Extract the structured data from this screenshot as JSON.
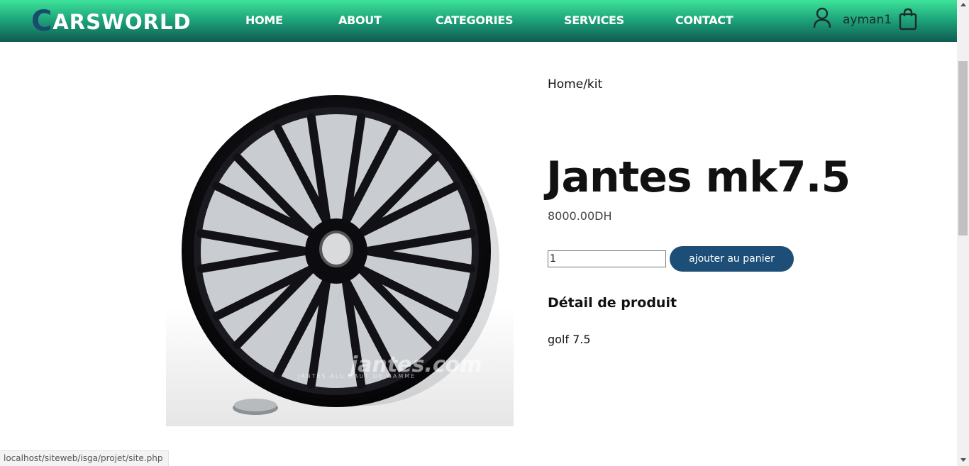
{
  "header": {
    "logo_first": "C",
    "logo_rest": "ARSWORLD",
    "nav": [
      {
        "label": "HOME"
      },
      {
        "label": "ABOUT"
      },
      {
        "label": "CATEGORIES"
      },
      {
        "label": "SERVICES"
      },
      {
        "label": "CONTACT"
      }
    ],
    "username": "ayman1",
    "icons": {
      "user": "user-icon",
      "cart": "shopping-bag-icon"
    }
  },
  "product": {
    "breadcrumb": "Home/kit",
    "title": "Jantes mk7.5",
    "price": "8000.00DH",
    "quantity": "1",
    "add_to_cart_label": "ajouter au panier",
    "detail_heading": "Détail de produit",
    "detail_text": "golf 7.5",
    "image_watermark": "jantes.com",
    "image_watermark_tagline": "JANTES ALU HAUT DE GAMME"
  },
  "status_url": "localhost/siteweb/isga/projet/site.php",
  "colors": {
    "nav_gradient_top": "#3ee39a",
    "nav_gradient_bottom": "#0e5c52",
    "logo_accent": "#184b6e",
    "button": "#1c4e78"
  }
}
